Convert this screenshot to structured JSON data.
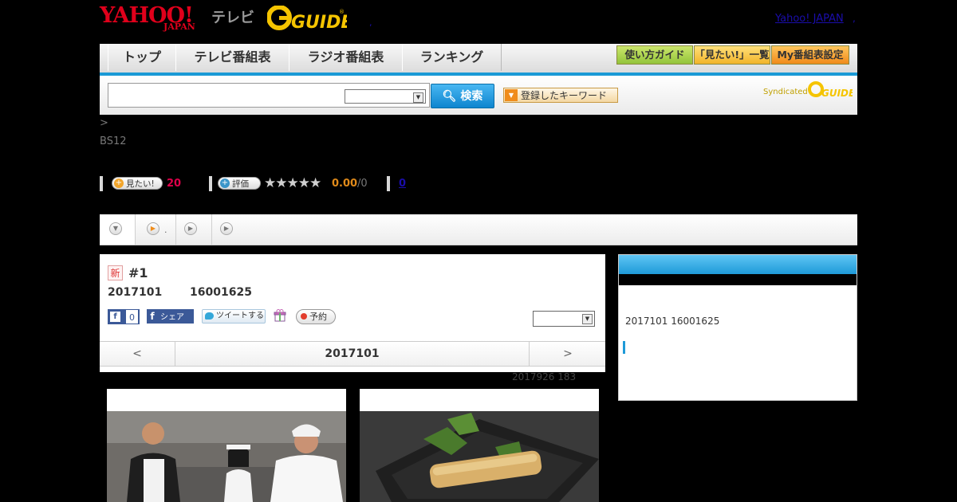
{
  "header": {
    "yahoo_logo": "YAHOO!",
    "japan_logo": "JAPAN",
    "tv_label": "テレビ",
    "gguide_logo": "G GUIDE",
    "yahoo_link": "Yahoo! JAPAN",
    "separator": ",",
    "separator2": ","
  },
  "nav": {
    "items": [
      "トップ",
      "テレビ番組表",
      "ラジオ番組表",
      "ランキング"
    ],
    "buttons": [
      "使い方ガイド",
      "「見たい!」一覧",
      "My番組表設定"
    ]
  },
  "search": {
    "button_label": "検索",
    "keyword_button": "登録したキーワード",
    "syndicated_label": "Syndicated"
  },
  "program": {
    "breadcrumb": ">",
    "channel": "BS12",
    "want_label": "見たい!",
    "want_count": "20",
    "rate_label": "評価",
    "rating_value": "0.00",
    "rating_count": "/0",
    "review_count": "0",
    "stars": "★★★★★"
  },
  "tabs": {
    "tab2_suffix": "."
  },
  "episode": {
    "new_badge": "新",
    "title": "#1",
    "date": "2017101",
    "time": "16001625",
    "like_count": "0",
    "share_label": "シェア",
    "tweet_label": "ツイートする",
    "reserve_label": "予約"
  },
  "pager": {
    "prev": "<",
    "current": "2017101",
    "next": ">"
  },
  "updated": "2017926  183",
  "side": {
    "info": "2017101  16001625"
  },
  "colors": {
    "accent_blue": "#1a9ad6",
    "yahoo_red": "#e0001b",
    "want_count_color": "#e0004a",
    "rating_color": "#e08a1a"
  }
}
